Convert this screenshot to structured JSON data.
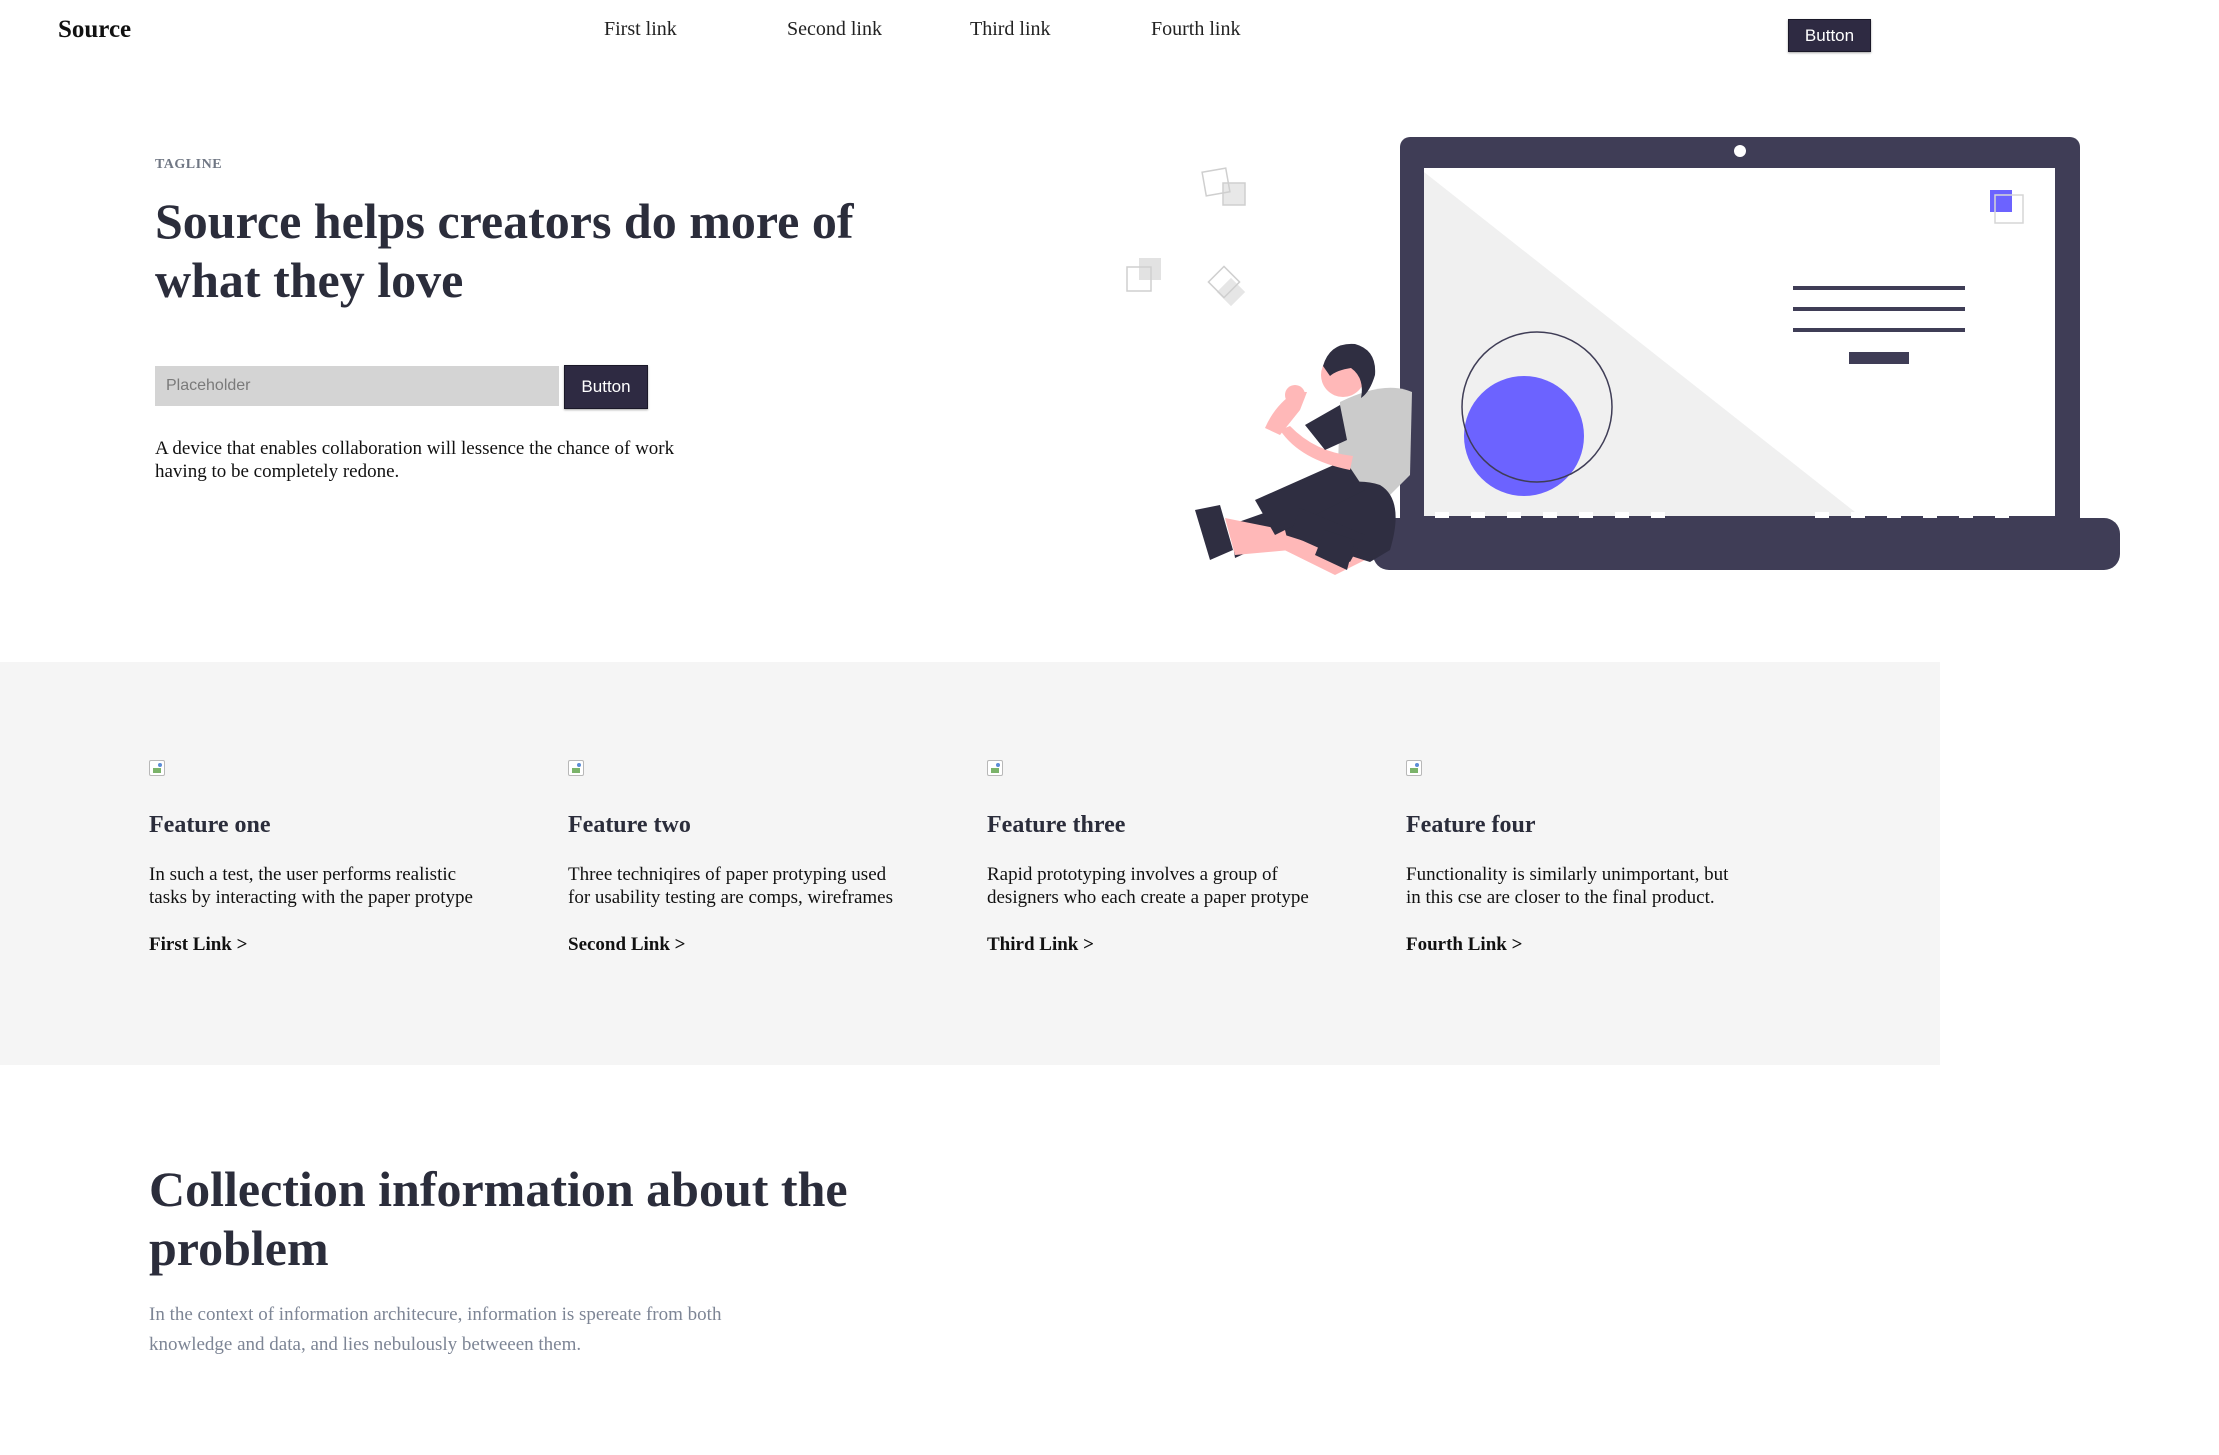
{
  "nav": {
    "logo": "Source",
    "links": [
      "First link",
      "Second link",
      "Third link",
      "Fourth link"
    ],
    "button": "Button"
  },
  "hero": {
    "tagline": "TAGLINE",
    "title": "Source helps creators do more of what they love",
    "input_placeholder": "Placeholder",
    "button": "Button",
    "description": "A device that enables collaboration will lessence the chance of work having to be completely redone."
  },
  "illustration": {
    "name": "person-with-laptop-illustration",
    "colors": {
      "dark": "#3f3d56",
      "accent": "#6c63ff",
      "skin": "#ffb8b8",
      "shirt": "#cbcbcb",
      "screen_shade": "#f0f0f0"
    }
  },
  "features": [
    {
      "icon": "broken-image-icon",
      "title": "Feature one",
      "text": "In such a test, the user performs realistic tasks by interacting with the paper protype",
      "link": "First Link >"
    },
    {
      "icon": "broken-image-icon",
      "title": "Feature two",
      "text": "Three techniqires of paper protyping used for usability testing are comps, wireframes",
      "link": "Second Link >"
    },
    {
      "icon": "broken-image-icon",
      "title": "Feature three",
      "text": "Rapid prototyping involves a group of designers who each create a paper protype",
      "link": "Third Link >"
    },
    {
      "icon": "broken-image-icon",
      "title": "Feature four",
      "text": "Functionality is similarly unimportant, but in this cse are closer to the final product.",
      "link": "Fourth Link >"
    }
  ],
  "collection": {
    "title": "Collection information about the problem",
    "text": "In the context of information architecure, information is spereate from both knowledge and data, and lies nebulously betweeen them."
  }
}
